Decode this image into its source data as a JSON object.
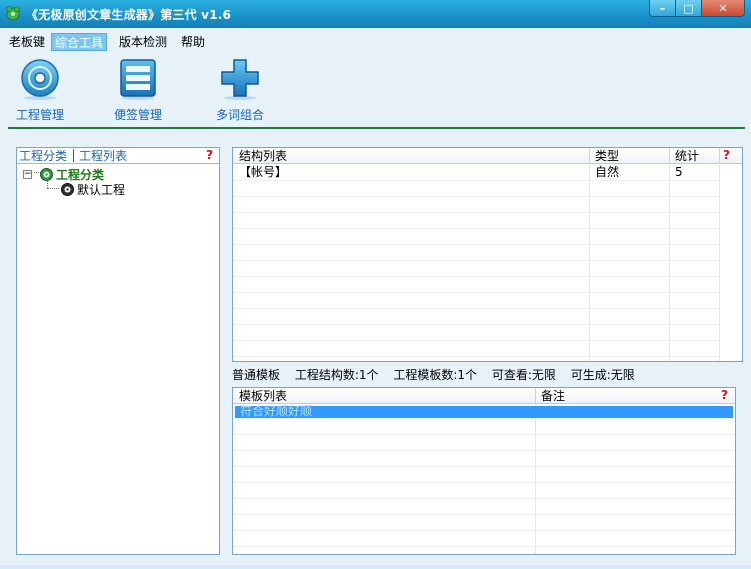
{
  "window": {
    "title": "《无极原创文章生成器》第三代  v1.6",
    "controls": {
      "minimize": "–",
      "maximize": "□",
      "close": "✕"
    }
  },
  "menu": [
    {
      "label": "老板键",
      "active": false
    },
    {
      "label": "综合工具",
      "active": true
    },
    {
      "label": "版本检测",
      "active": false
    },
    {
      "label": "帮助",
      "active": false
    }
  ],
  "toolbar": {
    "items": [
      {
        "label": "工程管理",
        "icon": "disc-icon"
      },
      {
        "label": "便签管理",
        "icon": "notes-icon"
      },
      {
        "label": "多词组合",
        "icon": "plus-icon"
      }
    ]
  },
  "left_panel": {
    "tabs": [
      "工程分类",
      "工程列表"
    ],
    "help": "?",
    "tree": {
      "root": {
        "label": "工程分类",
        "expander": "−"
      },
      "children": [
        {
          "label": "默认工程"
        }
      ]
    }
  },
  "structure_table": {
    "columns": [
      "结构列表",
      "类型",
      "统计"
    ],
    "help": "?",
    "rows": [
      {
        "name": "【帐号】",
        "type": "自然",
        "count": "5"
      }
    ]
  },
  "stats": {
    "mode": "普通模板",
    "structure_count": "工程结构数:1个",
    "template_count": "工程模板数:1个",
    "viewable": "可查看:无限",
    "generatable": "可生成:无限"
  },
  "template_table": {
    "columns": [
      "模板列表",
      "备注"
    ],
    "help": "?",
    "rows": [
      {
        "name": "符合好顺好顺",
        "note": "",
        "selected": true
      }
    ]
  },
  "colors": {
    "titlebar": "#1890c8",
    "accent_line": "#1d7a3a",
    "link_blue": "#1866b0",
    "selection": "#3399ff",
    "help_red": "#e01010"
  }
}
